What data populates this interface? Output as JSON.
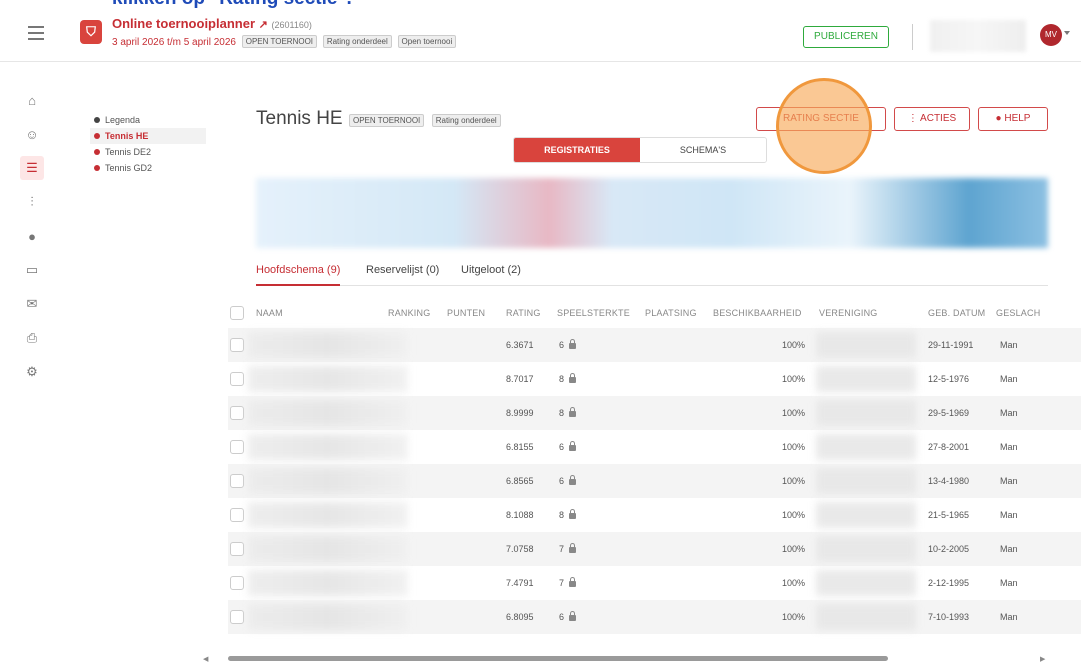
{
  "caption": {
    "prefix": "klikken op ",
    "bold": "\"Rating sectie\"."
  },
  "header": {
    "app_title": "Online toernooiplanner",
    "tournament_id": "(2601160)",
    "dates": "3 april 2026 t/m 5 april 2026",
    "tags": [
      "OPEN TOERNOOI",
      "Rating onderdeel",
      "Open toernooi"
    ],
    "publish_label": "PUBLICEREN",
    "avatar_initials": "MV"
  },
  "legend": {
    "title": "Legenda",
    "items": [
      "Tennis HE",
      "Tennis DE2",
      "Tennis GD2"
    ]
  },
  "main": {
    "title": "Tennis HE",
    "tags": [
      "OPEN TOERNOOI",
      "Rating onderdeel"
    ],
    "rating_label": "RATING SECTIE",
    "acties_label": "ACTIES",
    "help_label": "HELP",
    "segments": [
      "REGISTRATIES",
      "SCHEMA'S"
    ],
    "tabs": [
      "Hoofdschema (9)",
      "Reservelijst (0)",
      "Uitgeloot (2)"
    ]
  },
  "table": {
    "columns": [
      "NAAM",
      "RANKING",
      "PUNTEN",
      "RATING",
      "SPEELSTERKTE",
      "PLAATSING",
      "BESCHIKBAARHEID",
      "VERENIGING",
      "GEB. DATUM",
      "GESLACH"
    ],
    "rows": [
      {
        "rating": "6.3671",
        "strength": "6",
        "availability": "100%",
        "birth": "29-11-1991",
        "gender": "Man"
      },
      {
        "rating": "8.7017",
        "strength": "8",
        "availability": "100%",
        "birth": "12-5-1976",
        "gender": "Man"
      },
      {
        "rating": "8.9999",
        "strength": "8",
        "availability": "100%",
        "birth": "29-5-1969",
        "gender": "Man"
      },
      {
        "rating": "6.8155",
        "strength": "6",
        "availability": "100%",
        "birth": "27-8-2001",
        "gender": "Man"
      },
      {
        "rating": "6.8565",
        "strength": "6",
        "availability": "100%",
        "birth": "13-4-1980",
        "gender": "Man"
      },
      {
        "rating": "8.1088",
        "strength": "8",
        "availability": "100%",
        "birth": "21-5-1965",
        "gender": "Man"
      },
      {
        "rating": "7.0758",
        "strength": "7",
        "availability": "100%",
        "birth": "10-2-2005",
        "gender": "Man"
      },
      {
        "rating": "7.4791",
        "strength": "7",
        "availability": "100%",
        "birth": "2-12-1995",
        "gender": "Man"
      },
      {
        "rating": "6.8095",
        "strength": "6",
        "availability": "100%",
        "birth": "7-10-1993",
        "gender": "Man"
      }
    ]
  },
  "colors": {
    "brand": "#c62e34",
    "publish": "#2eaa3c",
    "highlight": "#f0983d"
  },
  "icons": [
    "menu-icon",
    "shield-logo-icon",
    "external-link-icon",
    "home-icon",
    "users-icon",
    "list-icon",
    "chart-icon",
    "globe-icon",
    "monitor-icon",
    "mail-icon",
    "print-icon",
    "settings-icon",
    "lock-icon"
  ]
}
